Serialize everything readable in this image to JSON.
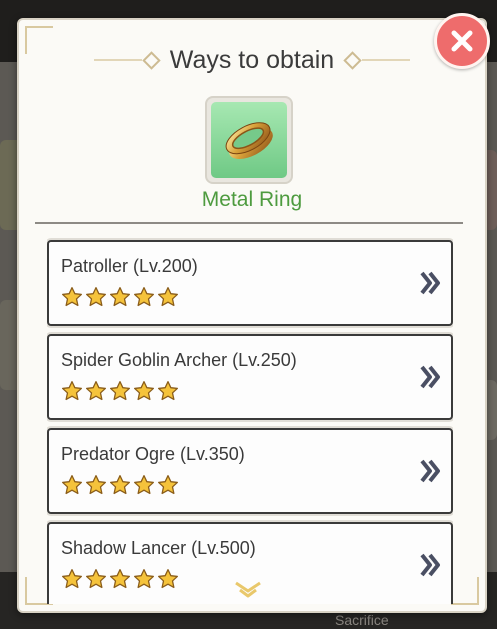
{
  "dialog": {
    "title": "Ways to obtain",
    "close_icon": "close-icon",
    "item": {
      "name": "Metal Ring",
      "icon": "ring-icon"
    }
  },
  "sources": [
    {
      "label": "Patroller (Lv.200)",
      "stars": 5
    },
    {
      "label": "Spider Goblin Archer (Lv.250)",
      "stars": 5
    },
    {
      "label": "Predator Ogre (Lv.350)",
      "stars": 5
    },
    {
      "label": "Shadow Lancer (Lv.500)",
      "stars": 5
    }
  ],
  "background": {
    "bottom_text": "Sacrifice"
  },
  "colors": {
    "accent_green": "#4e9b3f",
    "close_red": "#ee6c6c",
    "star_gold": "#f5c33b"
  }
}
